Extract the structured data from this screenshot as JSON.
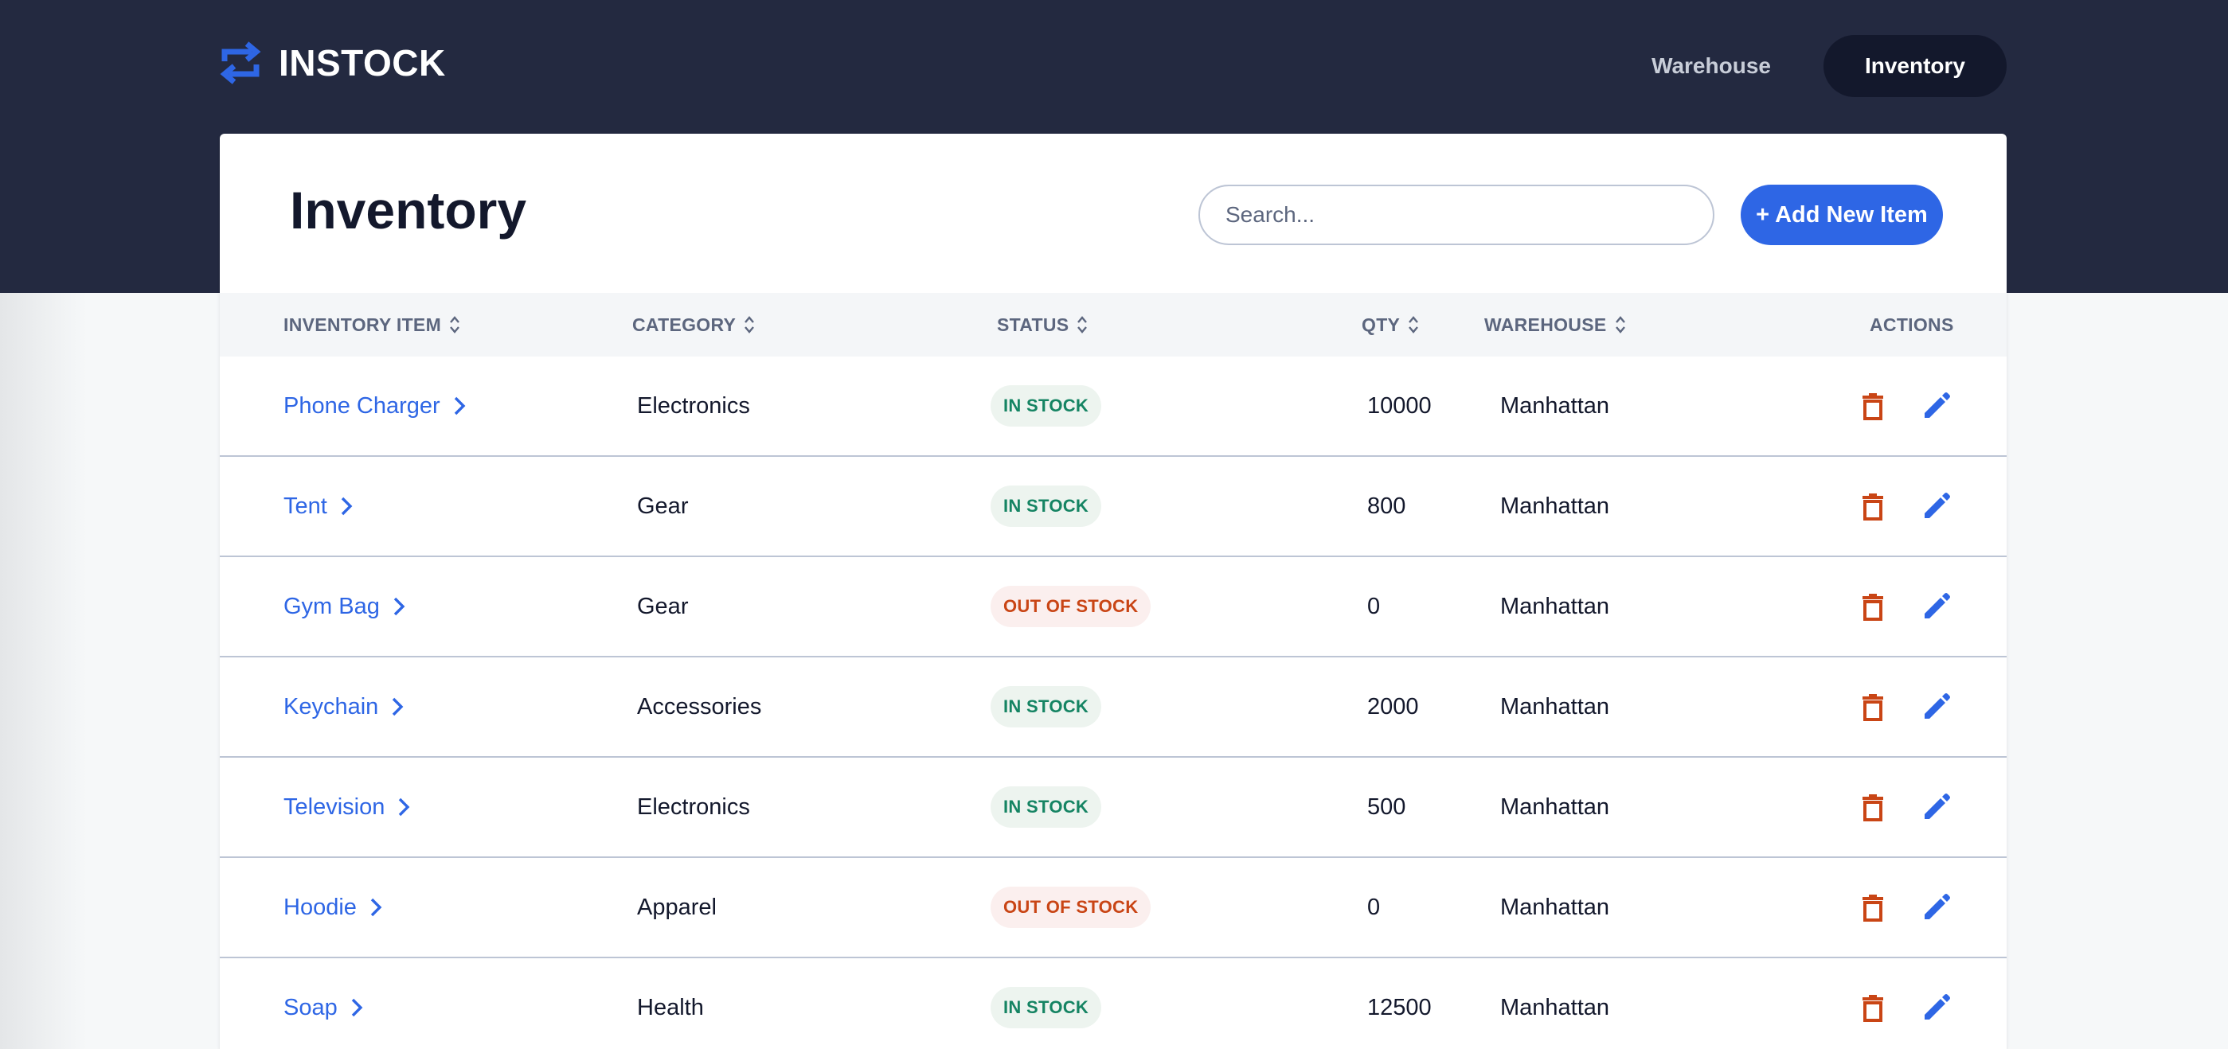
{
  "app": {
    "logo_text": "INSTOCK",
    "logo_icon": "swap-arrows-icon"
  },
  "nav": {
    "items": [
      {
        "label": "Warehouse",
        "active": false
      },
      {
        "label": "Inventory",
        "active": true
      }
    ]
  },
  "page": {
    "title": "Inventory",
    "search_placeholder": "Search...",
    "add_button_label": "+ Add New Item"
  },
  "table": {
    "columns": [
      {
        "label": "INVENTORY ITEM",
        "sortable": true
      },
      {
        "label": "CATEGORY",
        "sortable": true
      },
      {
        "label": "STATUS",
        "sortable": true
      },
      {
        "label": "QTY",
        "sortable": true
      },
      {
        "label": "WAREHOUSE",
        "sortable": true
      },
      {
        "label": "ACTIONS",
        "sortable": false
      }
    ],
    "rows": [
      {
        "item": "Phone Charger",
        "category": "Electronics",
        "status": "IN STOCK",
        "qty": "10000",
        "warehouse": "Manhattan"
      },
      {
        "item": "Tent",
        "category": "Gear",
        "status": "IN STOCK",
        "qty": "800",
        "warehouse": "Manhattan"
      },
      {
        "item": "Gym Bag",
        "category": "Gear",
        "status": "OUT OF STOCK",
        "qty": "0",
        "warehouse": "Manhattan"
      },
      {
        "item": "Keychain",
        "category": "Accessories",
        "status": "IN STOCK",
        "qty": "2000",
        "warehouse": "Manhattan"
      },
      {
        "item": "Television",
        "category": "Electronics",
        "status": "IN STOCK",
        "qty": "500",
        "warehouse": "Manhattan"
      },
      {
        "item": "Hoodie",
        "category": "Apparel",
        "status": "OUT OF STOCK",
        "qty": "0",
        "warehouse": "Manhattan"
      },
      {
        "item": "Soap",
        "category": "Health",
        "status": "IN STOCK",
        "qty": "12500",
        "warehouse": "Manhattan"
      }
    ],
    "row_icons": {
      "link": "chevron-right-icon",
      "delete": "trash-icon",
      "edit": "pencil-icon"
    }
  },
  "colors": {
    "header_bg": "#232940",
    "accent": "#2e66e5",
    "in_stock_text": "#158463",
    "in_stock_bg": "#edf4ef",
    "out_of_stock_text": "#c94515",
    "out_of_stock_bg": "#fbefee",
    "delete_icon": "#c94515"
  }
}
